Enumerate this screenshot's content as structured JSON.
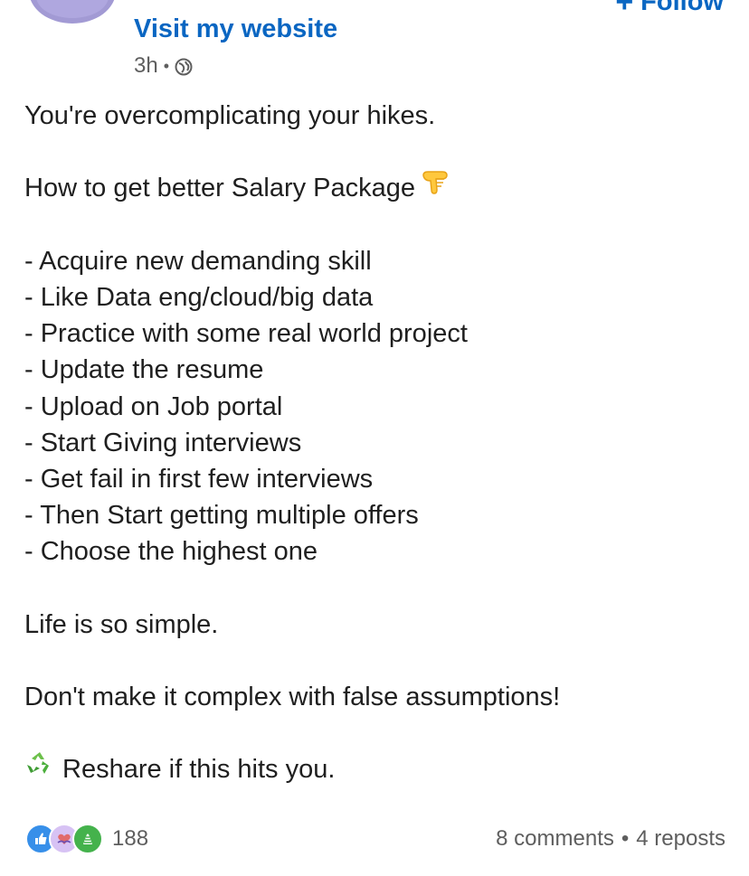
{
  "header": {
    "follow_plus": "+",
    "follow_label": "Follow",
    "website_link": "Visit my website",
    "time_ago": "3h",
    "separator": "•"
  },
  "post": {
    "lines": [
      "You're overcomplicating your hikes.",
      "",
      "How to get better Salary Package",
      "",
      "- Acquire new demanding skill",
      "- Like Data eng/cloud/big data",
      "- Practice with some real world project",
      "- Update the resume",
      "- Upload on Job portal",
      "- Start Giving interviews",
      "- Get fail in first few interviews",
      "- Then Start getting multiple offers",
      "- Choose the highest one",
      "",
      "Life is so simple.",
      "",
      "Don't make it complex with false assumptions!",
      "",
      "Reshare if this hits you."
    ],
    "emojis": {
      "pointing": "backhand-index-pointing-down-icon",
      "recycle": "recycle-icon"
    }
  },
  "footer": {
    "reaction_count": "188",
    "comments": "8 comments",
    "separator": "•",
    "reposts": "4 reposts",
    "reaction_icons": [
      "like-icon",
      "support-icon",
      "celebrate-icon"
    ]
  },
  "colors": {
    "accent": "#0a66c2",
    "text": "#1f1f1f",
    "muted": "#5e5e5e",
    "like": "#378fe9",
    "celebrate": "#44b24c",
    "recycle": "#6cc04a",
    "pointing": "#ffc83d"
  }
}
